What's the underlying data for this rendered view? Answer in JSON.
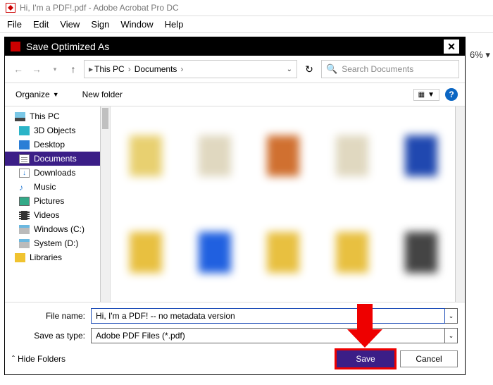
{
  "app": {
    "title": "Hi, I'm a PDF!.pdf - Adobe Acrobat Pro DC"
  },
  "menubar": [
    "File",
    "Edit",
    "View",
    "Sign",
    "Window",
    "Help"
  ],
  "zoom_fragment": "6%",
  "dialog": {
    "title": "Save Optimized As",
    "breadcrumb": [
      "This PC",
      "Documents"
    ],
    "search_placeholder": "Search Documents",
    "organize": "Organize",
    "new_folder": "New folder",
    "tree": [
      {
        "label": "This PC",
        "icon": "ic-pc",
        "lvl": 0
      },
      {
        "label": "3D Objects",
        "icon": "ic-3d",
        "lvl": 1
      },
      {
        "label": "Desktop",
        "icon": "ic-desk",
        "lvl": 1
      },
      {
        "label": "Documents",
        "icon": "ic-doc",
        "lvl": 1,
        "selected": true
      },
      {
        "label": "Downloads",
        "icon": "ic-dl",
        "lvl": 1
      },
      {
        "label": "Music",
        "icon": "ic-mus",
        "lvl": 1,
        "glyph": "♪"
      },
      {
        "label": "Pictures",
        "icon": "ic-pic",
        "lvl": 1
      },
      {
        "label": "Videos",
        "icon": "ic-vid",
        "lvl": 1
      },
      {
        "label": "Windows (C:)",
        "icon": "ic-drv",
        "lvl": 1
      },
      {
        "label": "System (D:)",
        "icon": "ic-drv",
        "lvl": 1
      },
      {
        "label": "Libraries",
        "icon": "ic-lib",
        "lvl": 0
      }
    ],
    "filename_label": "File name:",
    "filename_value": "Hi, I'm a PDF! -- no metadata version",
    "savetype_label": "Save as type:",
    "savetype_value": "Adobe PDF Files (*.pdf)",
    "hide_folders": "Hide Folders",
    "save": "Save",
    "cancel": "Cancel"
  }
}
